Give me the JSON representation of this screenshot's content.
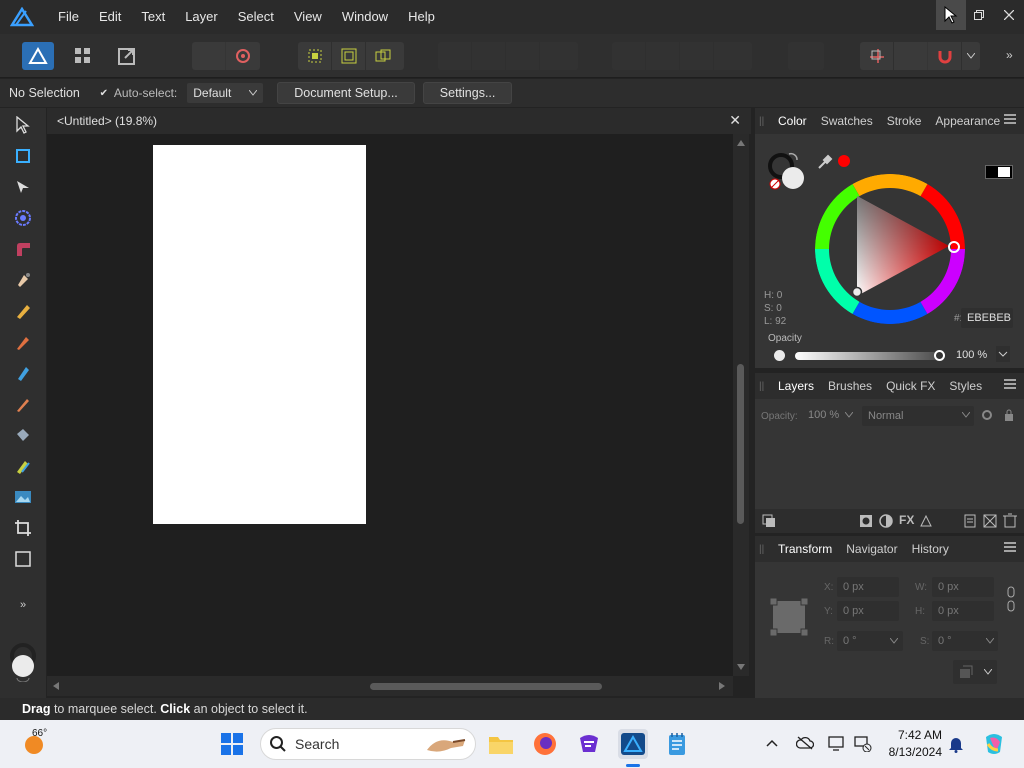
{
  "menubar": {
    "items": [
      "File",
      "Edit",
      "Text",
      "Layer",
      "Select",
      "View",
      "Window",
      "Help"
    ],
    "accent": "#1e90ff"
  },
  "context": {
    "selection": "No Selection",
    "autoselect_label": "Auto-select:",
    "autoselect_value": "Default",
    "document_setup": "Document Setup...",
    "settings": "Settings..."
  },
  "document": {
    "tab_title": "<Untitled> (19.8%)"
  },
  "color_panel": {
    "tabs": [
      "Color",
      "Swatches",
      "Stroke",
      "Appearance"
    ],
    "h": "H: 0",
    "s": "S: 0",
    "l": "L: 92",
    "hex_prefix": "#:",
    "hex": "EBEBEB",
    "opacity_label": "Opacity",
    "opacity_value": "100 %"
  },
  "layers_panel": {
    "tabs": [
      "Layers",
      "Brushes",
      "Quick FX",
      "Styles"
    ],
    "opacity_label": "Opacity:",
    "opacity_value": "100 %",
    "blend_mode": "Normal"
  },
  "transform_panel": {
    "tabs": [
      "Transform",
      "Navigator",
      "History"
    ],
    "x_label": "X:",
    "x_value": "0 px",
    "y_label": "Y:",
    "y_value": "0 px",
    "w_label": "W:",
    "w_value": "0 px",
    "h_label": "H:",
    "h_value": "0 px",
    "r_label": "R:",
    "r_value": "0 °",
    "s_label": "S:",
    "s_value": "0 °"
  },
  "statusbar": {
    "drag": "Drag",
    "drag_text": " to marquee select. ",
    "click": "Click",
    "click_text": " an object to select it."
  },
  "taskbar": {
    "weather": "66°",
    "search_placeholder": "Search",
    "time": "7:42 AM",
    "date": "8/13/2024"
  }
}
